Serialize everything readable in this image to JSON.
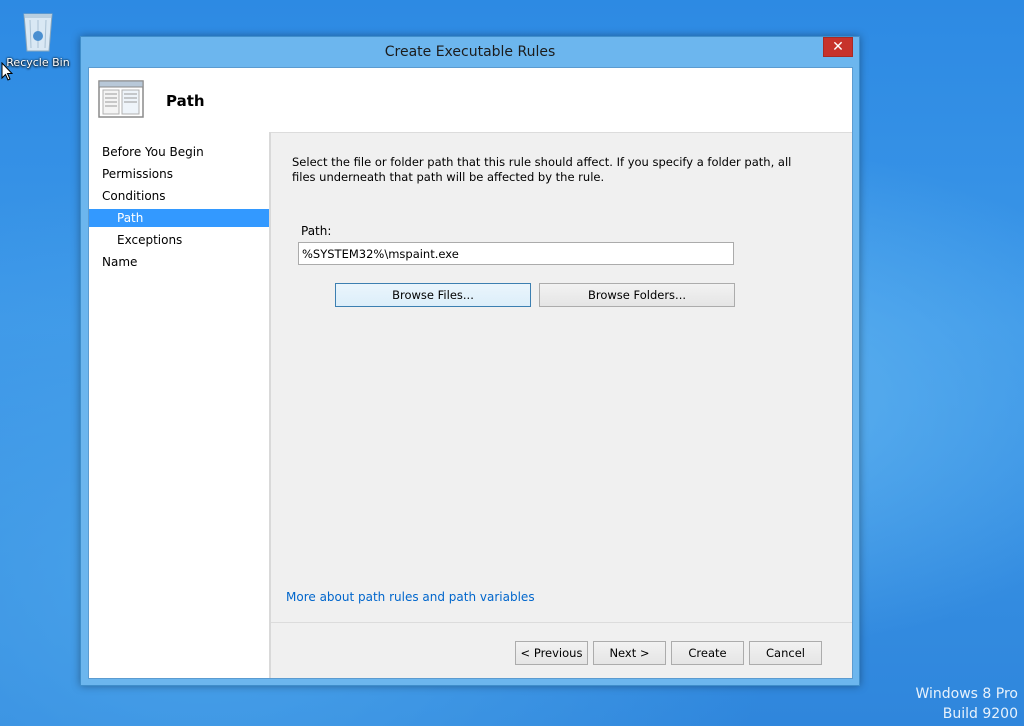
{
  "desktop": {
    "recycle_bin_label": "Recycle Bin",
    "watermark_line1": "Windows 8 Pro",
    "watermark_line2": "Build 9200"
  },
  "window": {
    "title": "Create Executable Rules",
    "close_glyph": "✕",
    "accent_color": "#6cb6ee"
  },
  "header": {
    "page_title": "Path",
    "icon": "wizard-page-icon"
  },
  "nav": {
    "items": [
      {
        "label": "Before You Begin",
        "active": false
      },
      {
        "label": "Permissions",
        "active": false
      },
      {
        "label": "Conditions",
        "active": false
      },
      {
        "label": "Path",
        "active": true
      },
      {
        "label": "Exceptions",
        "active": false
      },
      {
        "label": "Name",
        "active": false
      }
    ],
    "active_color": "#3399ff"
  },
  "main": {
    "description": "Select the file or folder path that this rule should affect. If you specify a folder path, all files underneath that path will be affected by the rule.",
    "path_label": "Path:",
    "path_value": "%SYSTEM32%\\mspaint.exe",
    "browse_files_label": "Browse Files...",
    "browse_folders_label": "Browse Folders...",
    "help_link": "More about path rules and path variables"
  },
  "footer": {
    "previous_label": "< Previous",
    "next_label": "Next >",
    "create_label": "Create",
    "cancel_label": "Cancel"
  }
}
